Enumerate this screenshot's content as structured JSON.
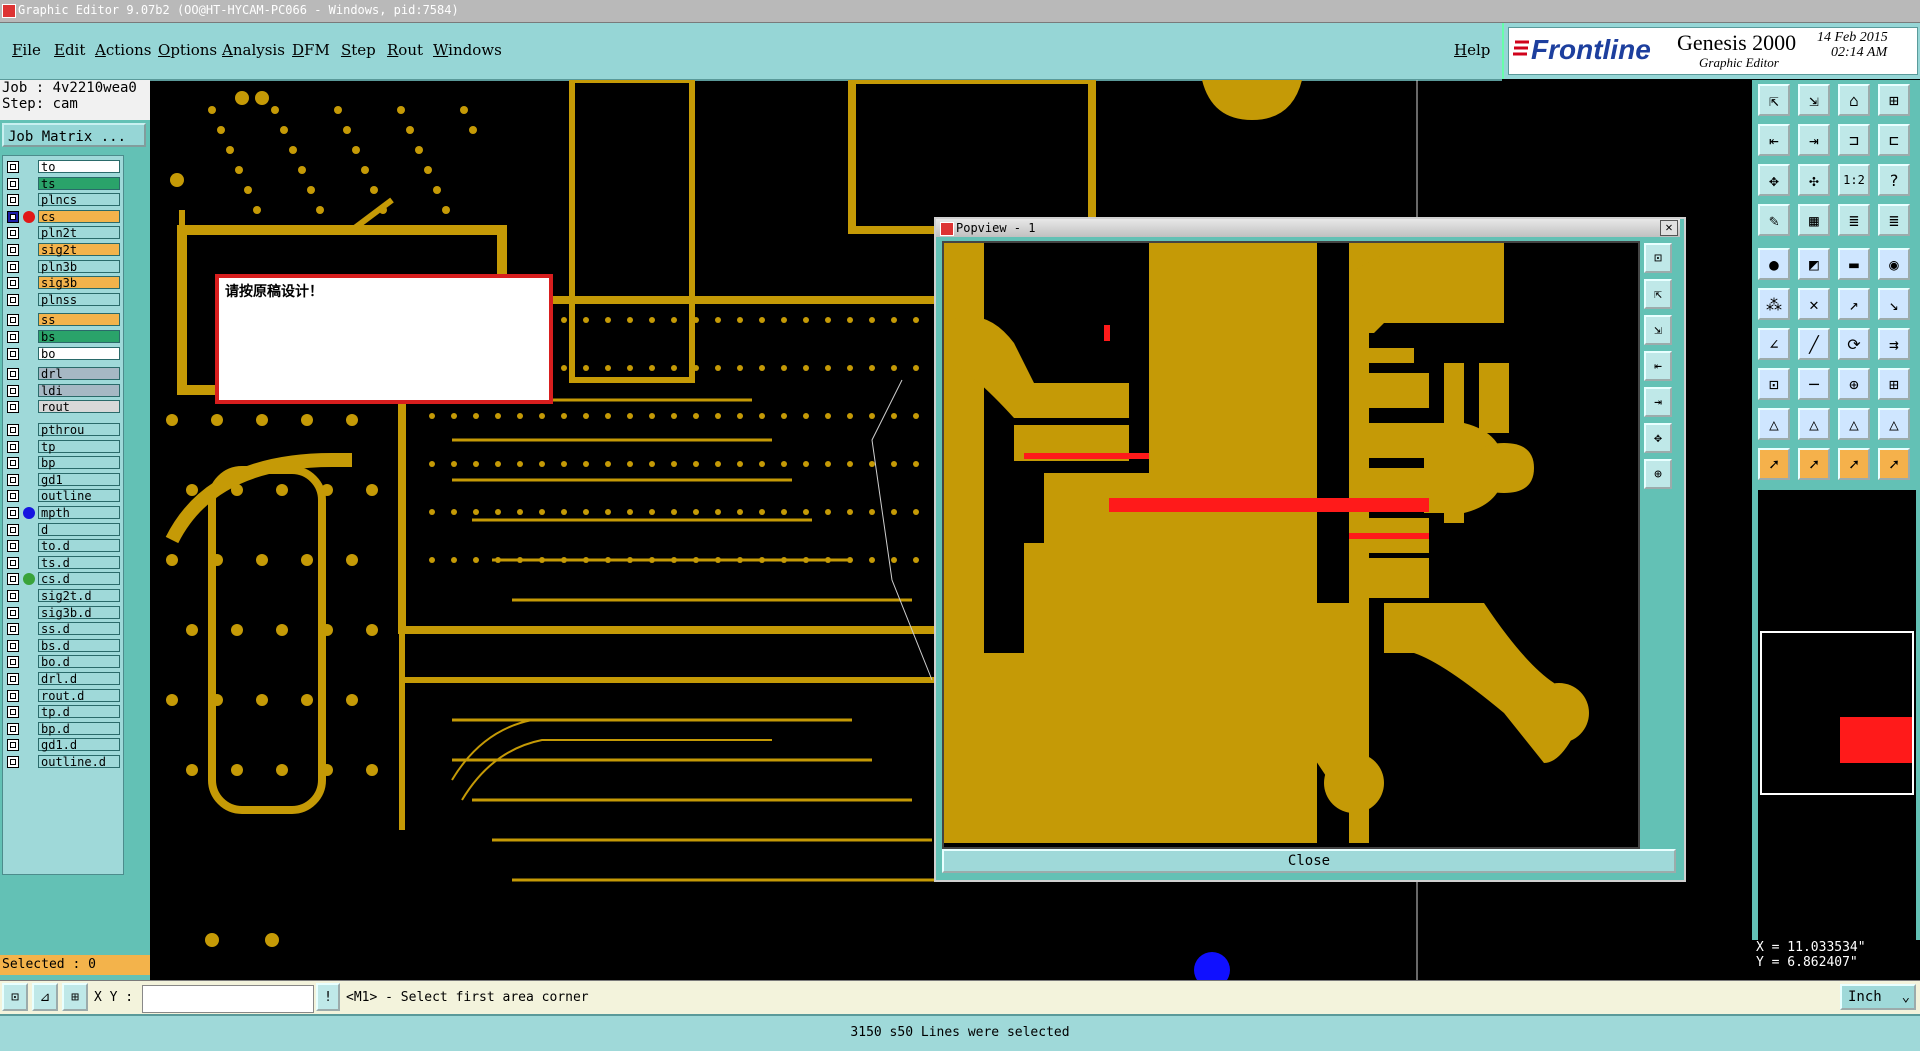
{
  "window": {
    "title": "Graphic Editor 9.07b2 (OO@HT-HYCAM-PC066 - Windows, pid:7584)"
  },
  "menu": {
    "items": [
      "File",
      "Edit",
      "Actions",
      "Options",
      "Analysis",
      "DFM",
      "Step",
      "Rout",
      "Windows"
    ],
    "help": "Help"
  },
  "brand": {
    "logo": "Frontline",
    "product": "Genesis 2000",
    "subtitle": "Graphic Editor",
    "date": "14 Feb 2015",
    "time": "02:14 AM"
  },
  "job": {
    "job_label": "Job : 4v2210wea0",
    "step_label": "Step: cam",
    "matrix_button": "Job Matrix ..."
  },
  "layers": [
    {
      "name": "to",
      "color": "#ffffff",
      "marker": ""
    },
    {
      "name": "ts",
      "color": "#2aa36a",
      "marker": ""
    },
    {
      "name": "plncs",
      "color": "#9fd9d9",
      "marker": ""
    },
    {
      "name": "cs",
      "color": "#f3b34b",
      "marker": "red"
    },
    {
      "name": "pln2t",
      "color": "#9fd9d9",
      "marker": ""
    },
    {
      "name": "sig2t",
      "color": "#f3b34b",
      "marker": ""
    },
    {
      "name": "pln3b",
      "color": "#9fd9d9",
      "marker": ""
    },
    {
      "name": "sig3b",
      "color": "#f3b34b",
      "marker": ""
    },
    {
      "name": "plnss",
      "color": "#9fd9d9",
      "marker": ""
    },
    {
      "name": "ss",
      "color": "#f3b34b",
      "marker": ""
    },
    {
      "name": "bs",
      "color": "#2aa36a",
      "marker": ""
    },
    {
      "name": "bo",
      "color": "#ffffff",
      "marker": ""
    },
    {
      "name": "drl",
      "color": "#a6b8c4",
      "marker": ""
    },
    {
      "name": "ldi",
      "color": "#a6b8c4",
      "marker": ""
    },
    {
      "name": "rout",
      "color": "#d8d8d8",
      "marker": ""
    },
    {
      "name": "pthrou",
      "color": "#9fd9d9",
      "marker": ""
    },
    {
      "name": "tp",
      "color": "#9fd9d9",
      "marker": ""
    },
    {
      "name": "bp",
      "color": "#9fd9d9",
      "marker": ""
    },
    {
      "name": "gd1",
      "color": "#9fd9d9",
      "marker": ""
    },
    {
      "name": "outline",
      "color": "#9fd9d9",
      "marker": ""
    },
    {
      "name": "mpth",
      "color": "#9fd9d9",
      "marker": "blue"
    },
    {
      "name": "d",
      "color": "#9fd9d9",
      "marker": ""
    },
    {
      "name": "to.d",
      "color": "#9fd9d9",
      "marker": ""
    },
    {
      "name": "ts.d",
      "color": "#9fd9d9",
      "marker": ""
    },
    {
      "name": "cs.d",
      "color": "#9fd9d9",
      "marker": "green"
    },
    {
      "name": "sig2t.d",
      "color": "#9fd9d9",
      "marker": ""
    },
    {
      "name": "sig3b.d",
      "color": "#9fd9d9",
      "marker": ""
    },
    {
      "name": "ss.d",
      "color": "#9fd9d9",
      "marker": ""
    },
    {
      "name": "bs.d",
      "color": "#9fd9d9",
      "marker": ""
    },
    {
      "name": "bo.d",
      "color": "#9fd9d9",
      "marker": ""
    },
    {
      "name": "drl.d",
      "color": "#9fd9d9",
      "marker": ""
    },
    {
      "name": "rout.d",
      "color": "#9fd9d9",
      "marker": ""
    },
    {
      "name": "tp.d",
      "color": "#9fd9d9",
      "marker": ""
    },
    {
      "name": "bp.d",
      "color": "#9fd9d9",
      "marker": ""
    },
    {
      "name": "gd1.d",
      "color": "#9fd9d9",
      "marker": ""
    },
    {
      "name": "outline.d",
      "color": "#9fd9d9",
      "marker": ""
    }
  ],
  "selected": "Selected : 0",
  "message": "请按原稿设计！",
  "popview": {
    "title": "Popview - 1",
    "close": "Close"
  },
  "coords": {
    "x": "X = 11.033534\"",
    "y": "Y = 6.862407\""
  },
  "command": {
    "xy_label": "X Y :",
    "input_value": "",
    "prompt": "<M1> - Select first area corner",
    "units": "Inch"
  },
  "status": "3150 s50 Lines were selected",
  "colors": {
    "copper": "#c59a06",
    "highlight": "#ff1a1a",
    "panel": "#96d6d6"
  }
}
